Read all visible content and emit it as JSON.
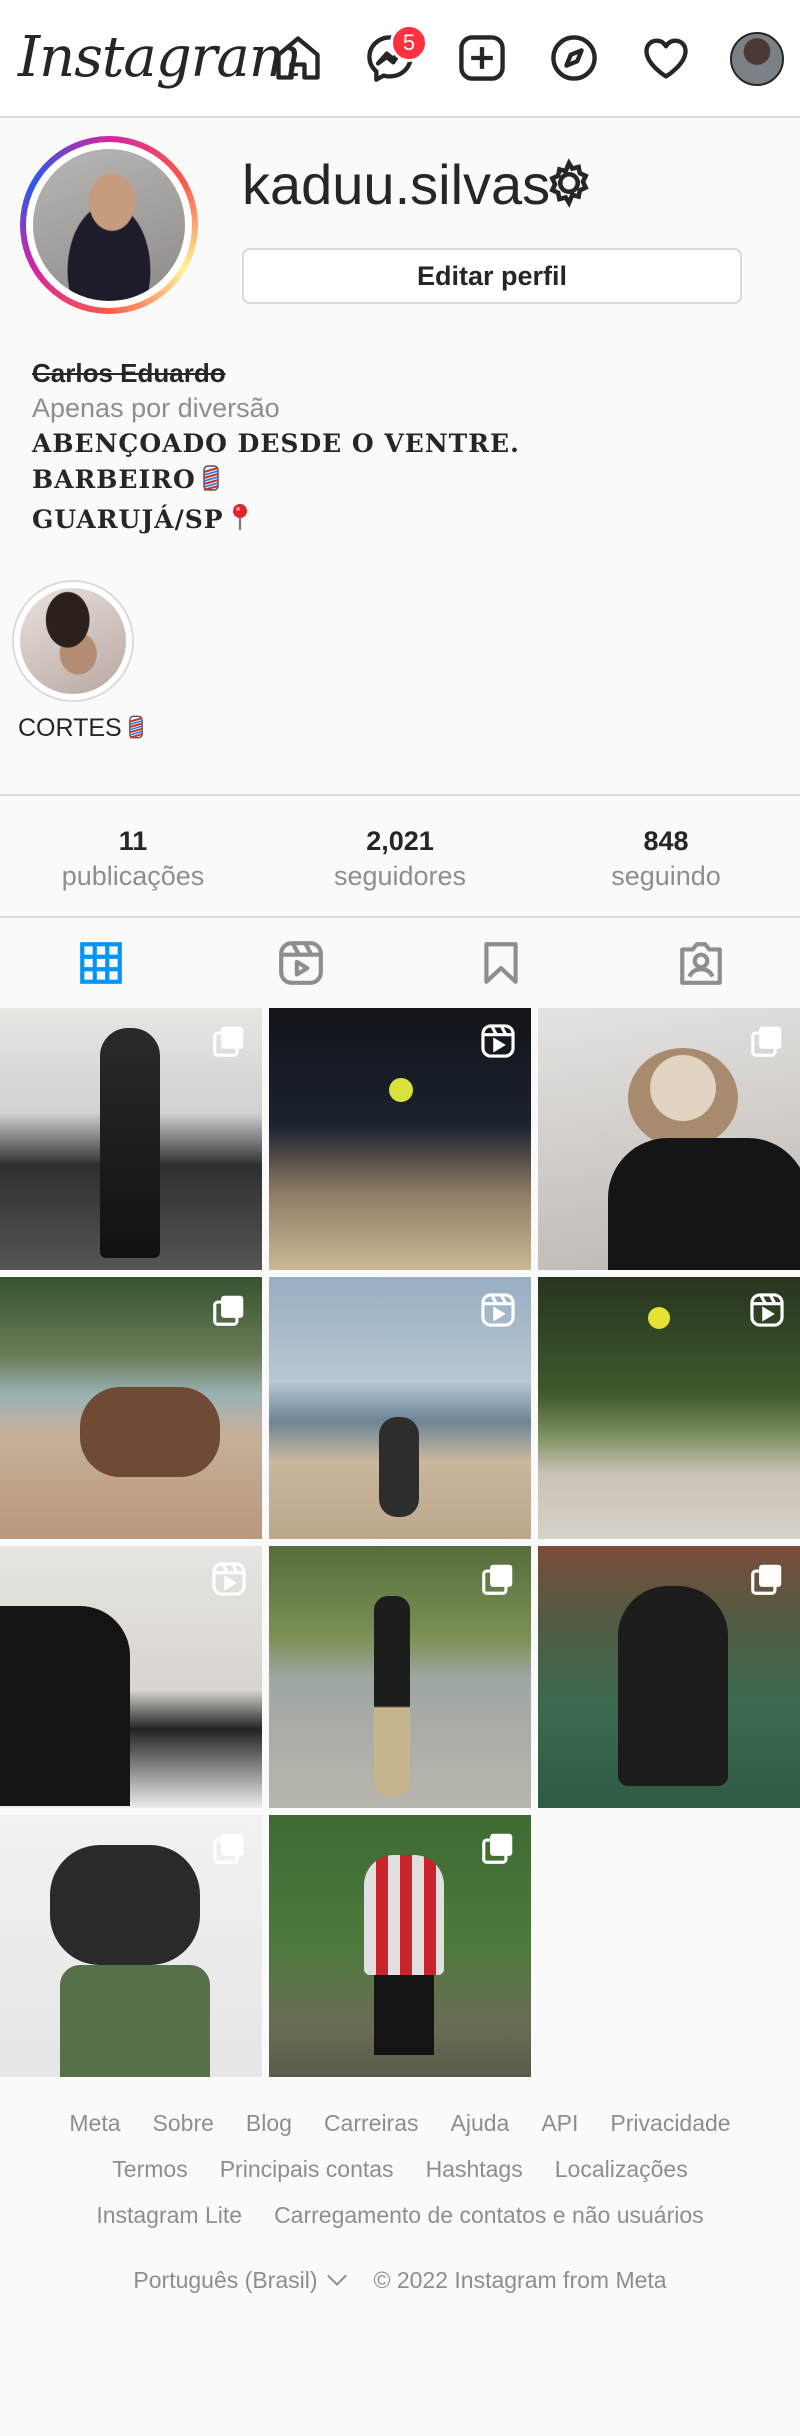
{
  "header": {
    "logo": "Instagram",
    "messages_badge": "5"
  },
  "profile": {
    "username": "kaduu.silvas",
    "edit_button": "Editar perfil",
    "full_name": "Carlos Eduardo",
    "category": "Apenas por diversão",
    "bio_lines": [
      "ABENÇOADO DESDE O VENTRE.",
      "BARBEIRO",
      "GUARUJÁ/SP"
    ]
  },
  "highlights": [
    {
      "label": "CORTES"
    }
  ],
  "stats": [
    {
      "value": "11",
      "label": "publicações"
    },
    {
      "value": "2,021",
      "label": "seguidores"
    },
    {
      "value": "848",
      "label": "seguindo"
    }
  ],
  "tabs": [
    {
      "name": "posts-tab",
      "icon": "grid-icon",
      "active": true
    },
    {
      "name": "reels-tab",
      "icon": "reels-icon",
      "active": false
    },
    {
      "name": "saved-tab",
      "icon": "bookmark-icon",
      "active": false
    },
    {
      "name": "tagged-tab",
      "icon": "tagged-icon",
      "active": false
    }
  ],
  "posts": [
    {
      "type": "carousel"
    },
    {
      "type": "reel"
    },
    {
      "type": "carousel"
    },
    {
      "type": "carousel"
    },
    {
      "type": "reel"
    },
    {
      "type": "reel"
    },
    {
      "type": "reel"
    },
    {
      "type": "carousel"
    },
    {
      "type": "carousel"
    },
    {
      "type": "carousel"
    },
    {
      "type": "carousel"
    }
  ],
  "footer": {
    "links_row1": [
      "Meta",
      "Sobre",
      "Blog",
      "Carreiras",
      "Ajuda",
      "API",
      "Privacidade"
    ],
    "links_row2": [
      "Termos",
      "Principais contas",
      "Hashtags",
      "Localizações"
    ],
    "links_row3": [
      "Instagram Lite",
      "Carregamento de contatos e não usuários"
    ],
    "language": "Português (Brasil)",
    "copyright": "© 2022 Instagram from Meta"
  },
  "colors": {
    "accent_blue": "#0095f6",
    "badge_red": "#ff3040",
    "muted_text": "#8e8e8e"
  }
}
